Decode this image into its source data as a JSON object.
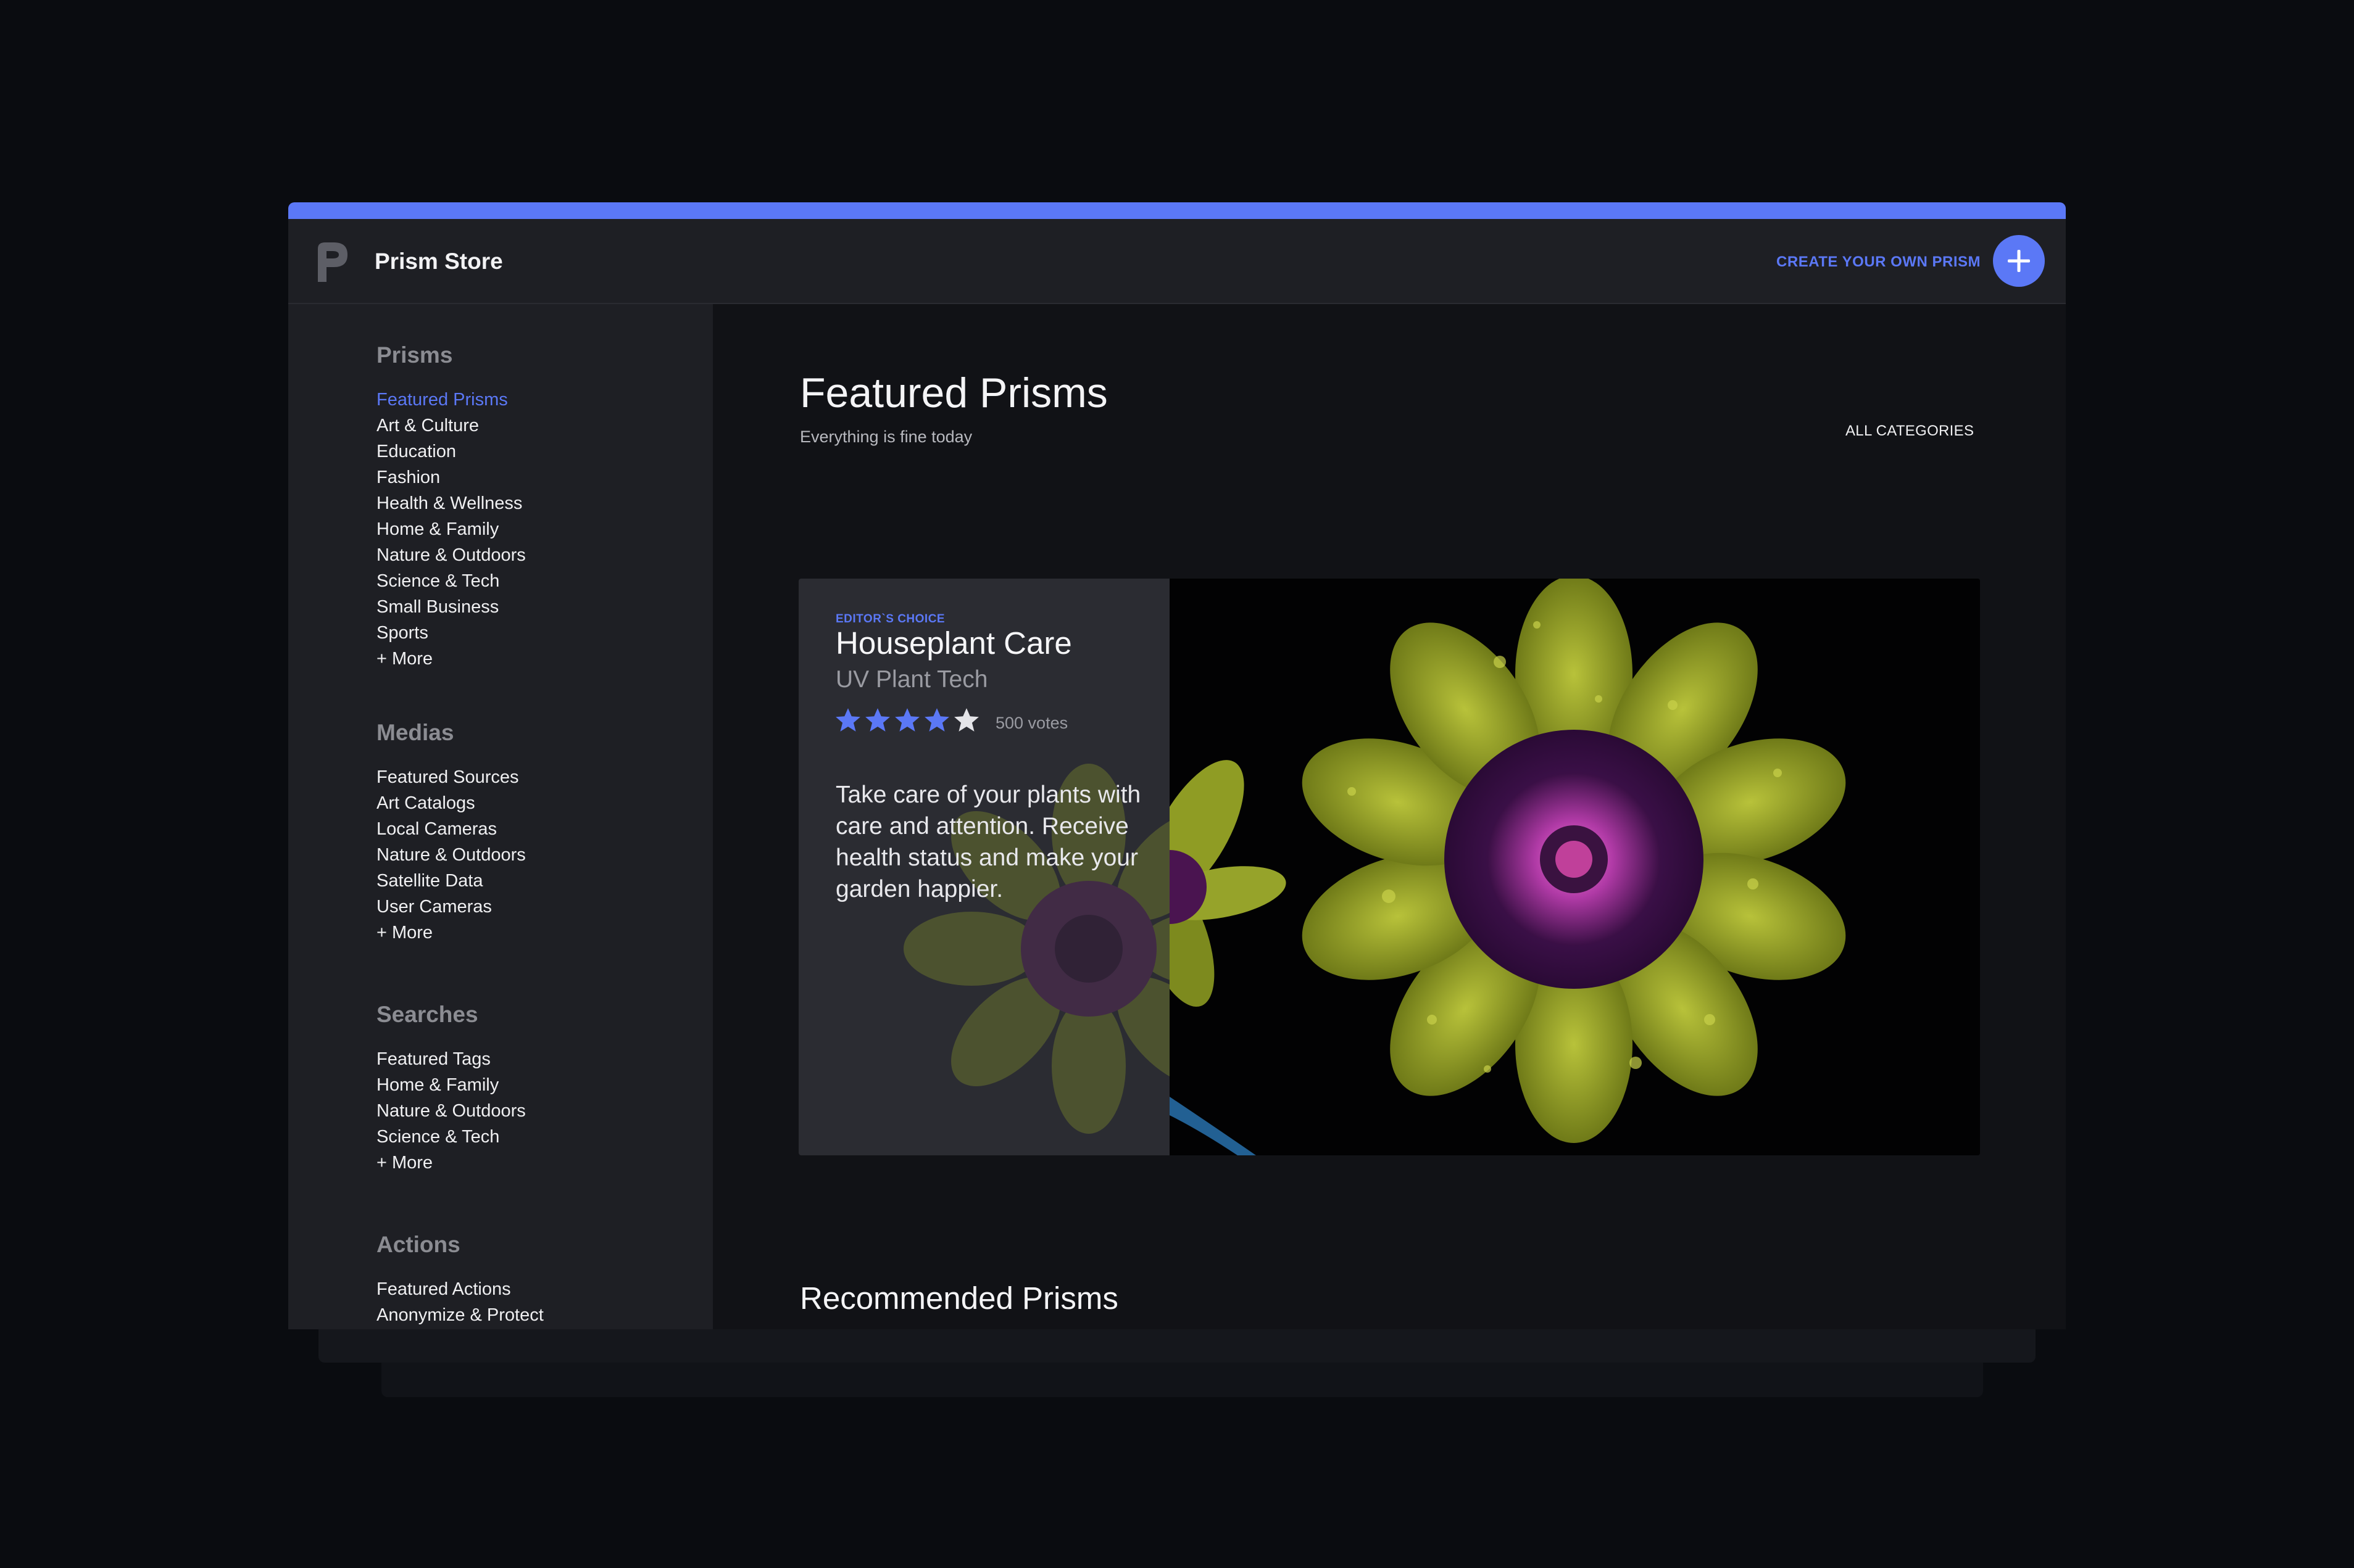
{
  "app": {
    "title": "Prism Store",
    "logo_icon": "prism-logo-icon",
    "create_label": "CREATE YOUR OWN PRISM",
    "accent": "#5b78f6"
  },
  "sidebar": {
    "sections": [
      {
        "title": "Prisms",
        "items": [
          "Featured Prisms",
          "Art & Culture",
          "Education",
          "Fashion",
          "Health & Wellness",
          "Home & Family",
          "Nature & Outdoors",
          "Science & Tech",
          "Small Business",
          "Sports",
          "+ More"
        ]
      },
      {
        "title": "Medias",
        "items": [
          "Featured Sources",
          "Art Catalogs",
          "Local Cameras",
          "Nature & Outdoors",
          "Satellite Data",
          "User Cameras",
          "+ More"
        ]
      },
      {
        "title": "Searches",
        "items": [
          "Featured Tags",
          "Home & Family",
          "Nature & Outdoors",
          "Science & Tech",
          "+ More"
        ]
      },
      {
        "title": "Actions",
        "items": [
          "Featured Actions",
          "Anonymize & Protect"
        ]
      }
    ],
    "active_item": "Featured Prisms"
  },
  "main": {
    "title": "Featured Prisms",
    "subtitle": "Everything is fine today",
    "all_categories": "ALL CATEGORIES",
    "featured": {
      "badge": "EDITOR`S CHOICE",
      "title": "Houseplant Care",
      "subtitle": "UV Plant Tech",
      "rating": 4,
      "rating_max": 5,
      "votes": "500 votes",
      "description": "Take care of your plants with care and attention. Receive health status and make your garden happier.",
      "image_icon": "uv-flower-image"
    },
    "recommended_title": "Recommended Prisms",
    "recommended": [
      {
        "image_icon": "baby-swings-image"
      },
      {
        "image_icon": "doorstep-packages-image"
      }
    ]
  }
}
